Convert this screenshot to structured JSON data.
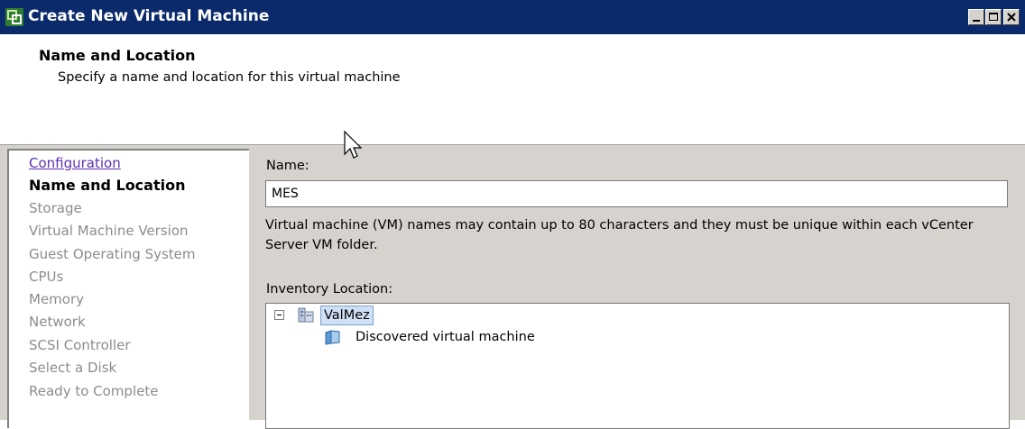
{
  "window": {
    "title": "Create New Virtual Machine",
    "controls": [
      "minimize",
      "maximize",
      "close"
    ]
  },
  "header": {
    "title": "Name and Location",
    "subtitle": "Specify a name and location for this virtual machine"
  },
  "steps": [
    {
      "label": "Configuration",
      "state": "link"
    },
    {
      "label": "Name and Location",
      "state": "current"
    },
    {
      "label": "Storage",
      "state": "future"
    },
    {
      "label": "Virtual Machine Version",
      "state": "future"
    },
    {
      "label": "Guest Operating System",
      "state": "future"
    },
    {
      "label": "CPUs",
      "state": "future"
    },
    {
      "label": "Memory",
      "state": "future"
    },
    {
      "label": "Network",
      "state": "future"
    },
    {
      "label": "SCSI Controller",
      "state": "future"
    },
    {
      "label": "Select a Disk",
      "state": "future"
    },
    {
      "label": "Ready to Complete",
      "state": "future"
    }
  ],
  "form": {
    "name_label": "Name:",
    "name_value": "MES",
    "description": "Virtual machine (VM) names may contain up to 80 characters and they must be unique within each vCenter Server VM folder.",
    "inventory_label": "Inventory Location:"
  },
  "inventory": {
    "root": {
      "label": "ValMez",
      "icon": "datacenter-icon",
      "expanded": true,
      "selected": true
    },
    "children": [
      {
        "label": "Discovered virtual machine",
        "icon": "folder-icon"
      }
    ]
  },
  "colors": {
    "titlebar": "#0b2a6b",
    "dialog_bg": "#d6d3ce",
    "link": "#5b2fb3",
    "disabled_text": "#8c8c8c",
    "selection": "#cfe0f5"
  }
}
